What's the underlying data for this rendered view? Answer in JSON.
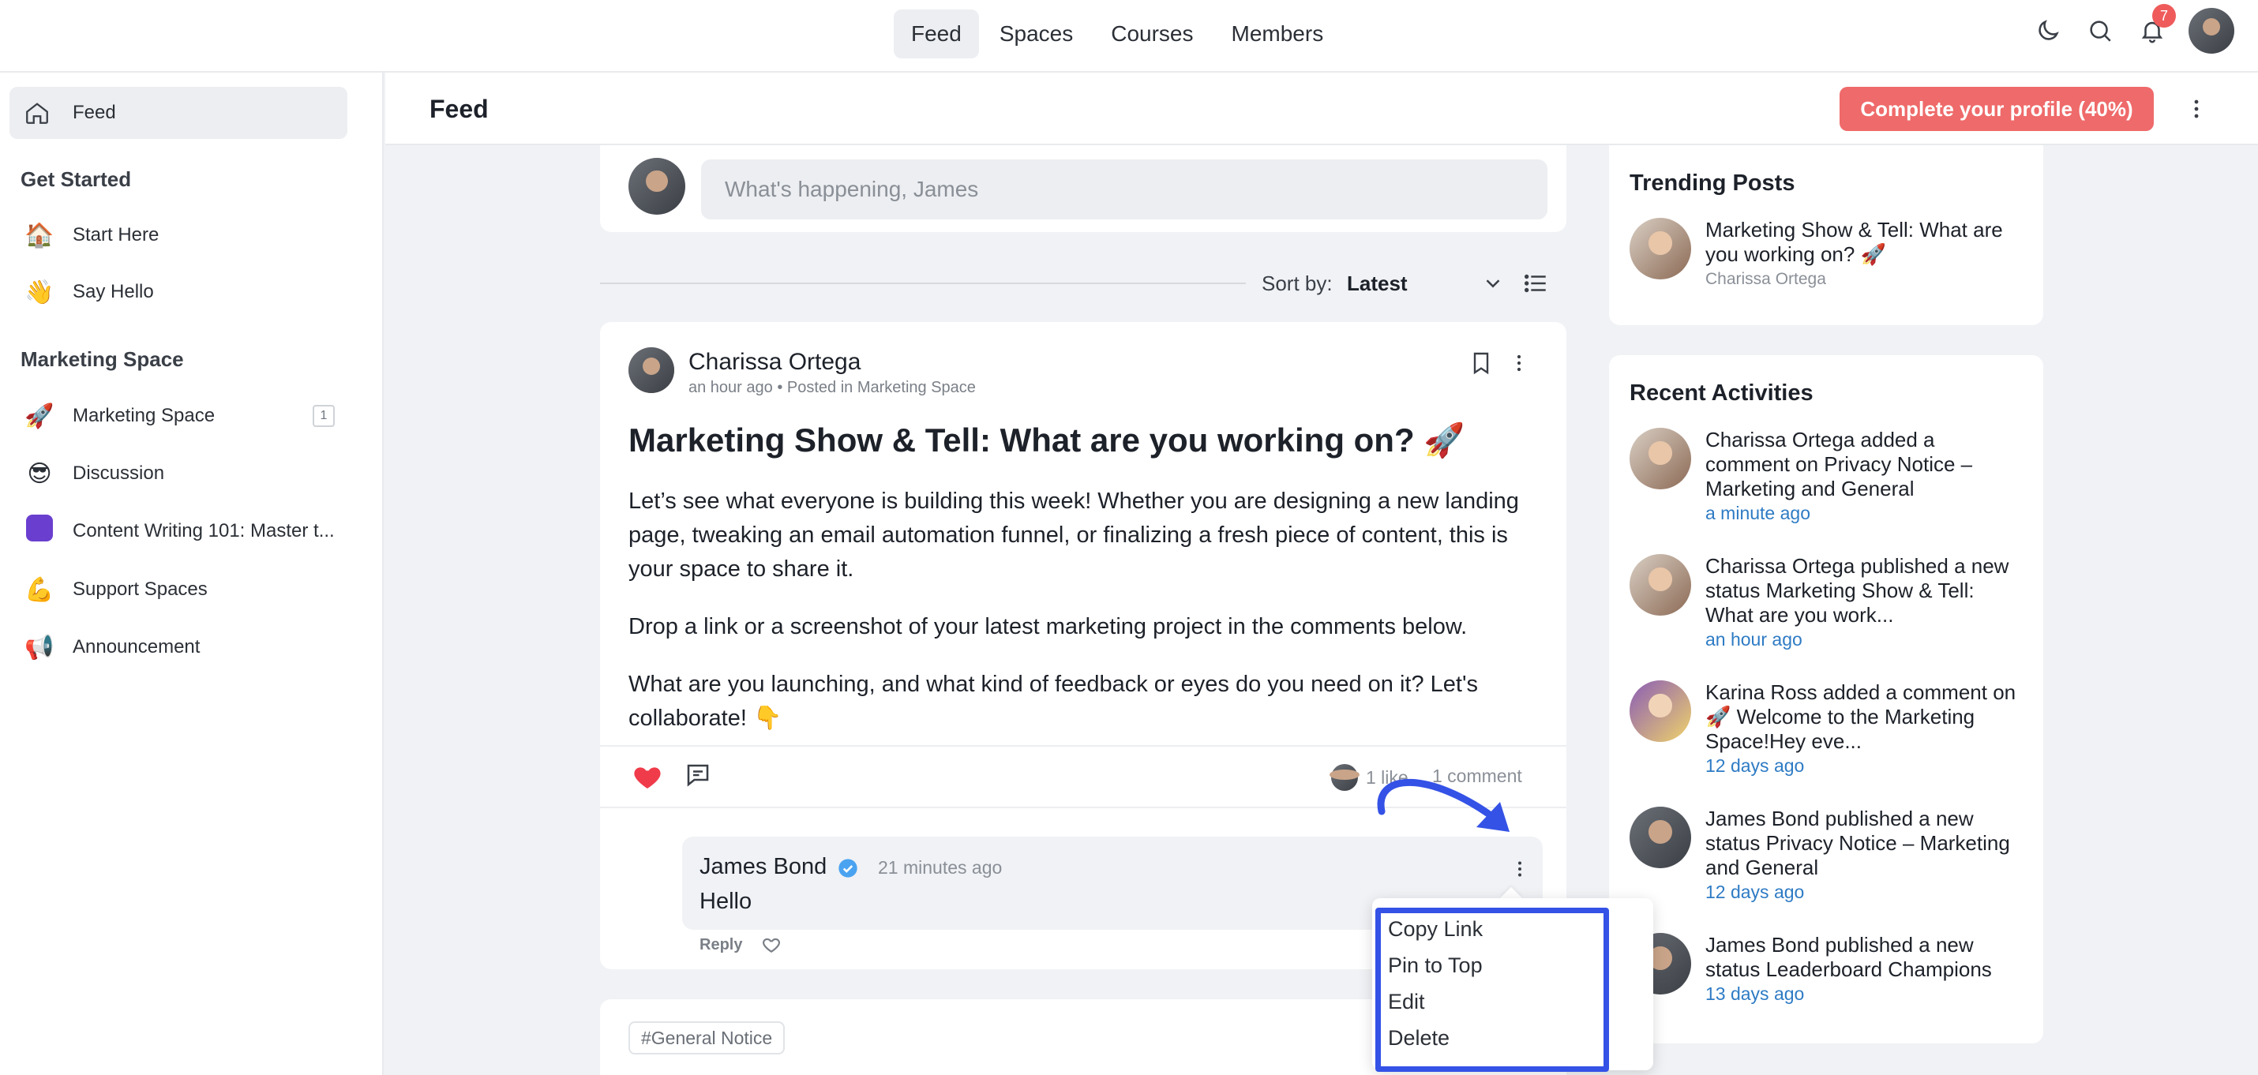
{
  "topnav": {
    "tabs": [
      {
        "label": "Feed",
        "active": true
      },
      {
        "label": "Spaces"
      },
      {
        "label": "Courses"
      },
      {
        "label": "Members"
      }
    ],
    "notification_count": "7",
    "icons": [
      "moon-icon",
      "search-icon",
      "bell-icon",
      "user-avatar"
    ]
  },
  "sidebar": {
    "feed_label": "Feed",
    "get_started_heading": "Get Started",
    "get_started_items": [
      {
        "emoji": "🏠",
        "label": "Start Here"
      },
      {
        "emoji": "👋",
        "label": "Say Hello"
      }
    ],
    "marketing_heading": "Marketing Space",
    "marketing_items": [
      {
        "emoji": "🚀",
        "label": "Marketing Space",
        "count": "1"
      },
      {
        "emoji": "😎",
        "label": "Discussion"
      },
      {
        "emoji": "",
        "label": "Content Writing 101: Master t..."
      },
      {
        "emoji": "💪",
        "label": "Support Spaces"
      },
      {
        "emoji": "📢",
        "label": "Announcement"
      }
    ]
  },
  "header": {
    "title": "Feed",
    "cta_label": "Complete your profile (40%)"
  },
  "composer": {
    "placeholder": "What's happening, James"
  },
  "sort": {
    "label": "Sort by:",
    "value": "Latest"
  },
  "post": {
    "author": "Charissa Ortega",
    "meta": "an hour ago • Posted in Marketing Space",
    "title": "Marketing Show & Tell: What are you working on? 🚀",
    "paragraphs": [
      "Let’s see what everyone is building this week! Whether you are designing a new landing page, tweaking an email automation funnel, or finalizing a fresh piece of content, this is your space to share it.",
      "Drop a link or a screenshot of your latest marketing project in the comments below.",
      "What are you launching, and what kind of feedback or eyes do you need on it? Let's collaborate! 👇"
    ],
    "likes": "1 like",
    "comments": "1 comment",
    "comment": {
      "author": "James Bond",
      "time": "21 minutes ago",
      "text": "Hello",
      "reply_label": "Reply"
    }
  },
  "next_post": {
    "tag": "#General Notice"
  },
  "context_menu": {
    "items": [
      "Copy Link",
      "Pin to Top",
      "Edit",
      "Delete"
    ]
  },
  "trending": {
    "title": "Trending Posts",
    "items": [
      {
        "title": "Marketing Show & Tell: What are you working on? 🚀",
        "author": "Charissa Ortega"
      }
    ]
  },
  "recent": {
    "title": "Recent Activities",
    "items": [
      {
        "actor": "Charissa Ortega",
        "action": " added a comment on ",
        "target": "Privacy Notice – Marketing and General",
        "ago": "a minute ago"
      },
      {
        "actor": "Charissa Ortega",
        "action": " published a new status ",
        "target": "Marketing Show & Tell: What are you work...",
        "ago": "an hour ago"
      },
      {
        "actor": "Karina Ross",
        "action": " added a comment on ",
        "target": "🚀 Welcome to the Marketing Space!Hey eve...",
        "ago": "12 days ago"
      },
      {
        "actor": "James Bond",
        "action": " published a new status ",
        "target": "Privacy Notice – Marketing and General",
        "ago": "12 days ago"
      },
      {
        "actor": "James Bond",
        "action": " published a new status ",
        "target": "Leaderboard Champions",
        "ago": "13 days ago"
      }
    ]
  },
  "colors": {
    "accent_cta": "#ef6a6a",
    "link_blue": "#2e7bc4",
    "annotation_blue": "#3452e6",
    "like_red": "#ef3b4a",
    "verified_blue": "#4aa3f0"
  }
}
